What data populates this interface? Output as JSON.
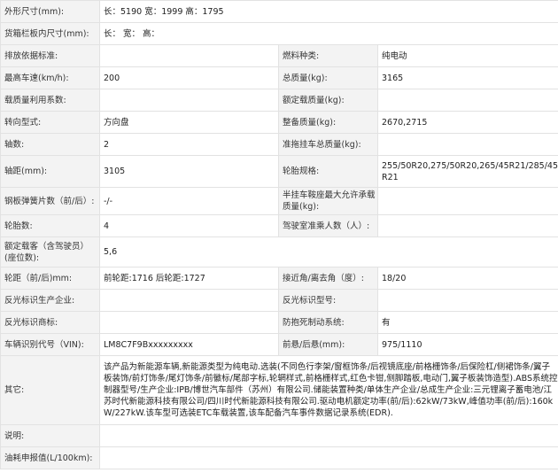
{
  "rows": {
    "dims": {
      "label": "外形尺寸(mm):",
      "value": "长：5190 宽：1999 高：1795"
    },
    "cargo_dims": {
      "label": "货箱栏板内尺寸(mm):",
      "value": "长： 宽： 高："
    },
    "emission": {
      "label": "排放依据标准:",
      "value": "",
      "label2": "燃料种类:",
      "value2": "纯电动"
    },
    "max_speed": {
      "label": "最高车速(km/h):",
      "value": "200",
      "label2": "总质量(kg):",
      "value2": "3165"
    },
    "load_factor": {
      "label": "载质量利用系数:",
      "value": "",
      "label2": "额定载质量(kg):",
      "value2": ""
    },
    "steering": {
      "label": "转向型式:",
      "value": "方向盘",
      "label2": "整备质量(kg):",
      "value2": "2670,2715"
    },
    "axles": {
      "label": "轴数:",
      "value": "2",
      "label2": "准拖挂车总质量(kg):",
      "value2": ""
    },
    "wheelbase": {
      "label": "轴距(mm):",
      "value": "3105",
      "label2": "轮胎规格:",
      "value2": "255/50R20,275/50R20,265/45R21/285/45R21"
    },
    "springs": {
      "label": "钢板弹簧片数（前/后）:",
      "value": "-/-",
      "label2": "半挂车鞍座最大允许承载质量(kg):",
      "value2": ""
    },
    "tires": {
      "label": "轮胎数:",
      "value": "4",
      "label2": "驾驶室准乘人数（人）:",
      "value2": ""
    },
    "seats": {
      "label": "额定载客（含驾驶员）(座位数):",
      "value": "5,6"
    },
    "track": {
      "label": "轮距（前/后)mm:",
      "value": "前轮距:1716 后轮距:1727",
      "label2": "接近角/离去角（度）:",
      "value2": "18/20"
    },
    "reflector_maker": {
      "label": "反光标识生产企业:",
      "value": "",
      "label2": "反光标识型号:",
      "value2": ""
    },
    "reflector_brand": {
      "label": "反光标识商标:",
      "value": "",
      "label2": "防抱死制动系统:",
      "value2": "有"
    },
    "vin": {
      "label": "车辆识别代号（VIN):",
      "value": "LM8C7F9Bxxxxxxxxx",
      "label2": "前悬/后悬(mm):",
      "value2": "975/1110"
    },
    "other": {
      "label": "其它:",
      "value": "该产品为新能源车辆,新能源类型为纯电动.选装(不同色行李架/窗框饰条/后视镜底座/前格栅饰条/后保险杠/侧裙饰条/翼子板装饰/前灯饰条/尾灯饰条/前徽标/尾部字标,轮辋样式,前格栅样式,红色卡钳,侧脚踏板,电动门,翼子板装饰造型).ABS系统控制器型号/生产企业:IPB/博世汽车部件（苏州）有限公司.储能装置种类/单体生产企业/总成生产企业:三元锂离子蓄电池/江苏时代新能源科技有限公司/四川时代新能源科技有限公司.驱动电机额定功率(前/后):62kW/73kW,峰值功率(前/后):160kW/227kW.该车型可选装ETC车载装置,该车配备汽车事件数据记录系统(EDR)."
    },
    "remarks": {
      "label": "说明:",
      "value": ""
    },
    "fuel": {
      "label": "油耗申报值(L/100km):",
      "value": ""
    }
  }
}
